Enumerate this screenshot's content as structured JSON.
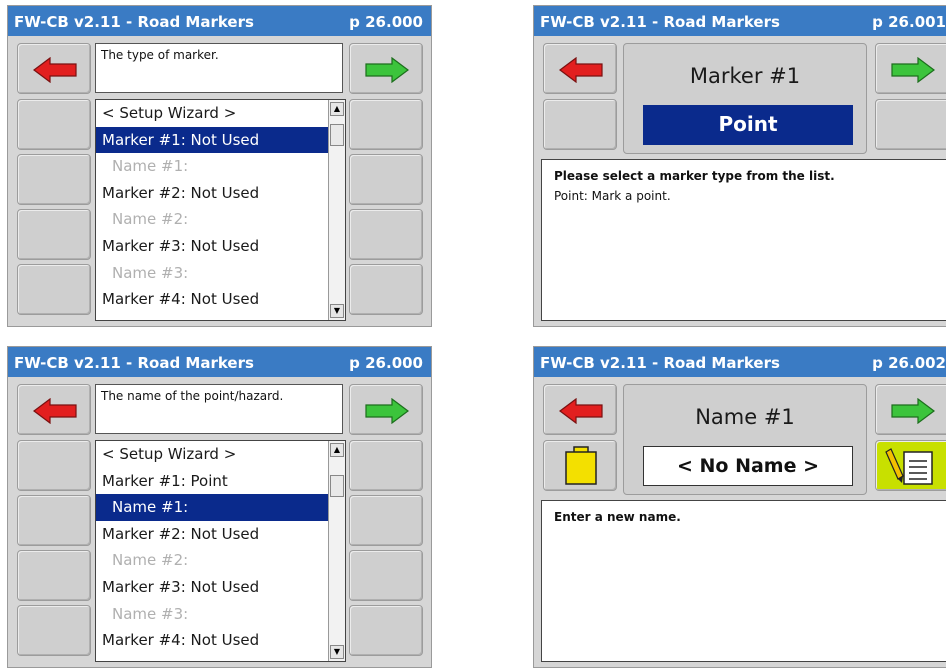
{
  "colors": {
    "title_bar": "#3a7bc4",
    "selection": "#0a2a8c",
    "back_arrow": "#e21f1f",
    "next_arrow": "#3cc43c",
    "folder": "#f3e000",
    "notepad_button": "#c8e000"
  },
  "screens": {
    "top_left": {
      "title": "FW-CB v2.11 - Road Markers",
      "page": "p 26.000",
      "description": "The type of marker.",
      "list": [
        "< Setup Wizard >",
        "Marker #1: Not Used",
        "Name #1:",
        "Marker #2: Not Used",
        "Name #2:",
        "Marker #3: Not Used",
        "Name #3:",
        "Marker #4: Not Used"
      ],
      "selected_index": 1
    },
    "top_right": {
      "title": "FW-CB v2.11 - Road Markers",
      "page": "p 26.001",
      "heading": "Marker #1",
      "value": "Point",
      "help_bold": "Please select a marker type from the list.",
      "help_text": "Point: Mark a point."
    },
    "bottom_left": {
      "title": "FW-CB v2.11 - Road Markers",
      "page": "p 26.000",
      "description": "The name of the point/hazard.",
      "list": [
        "< Setup Wizard >",
        "Marker #1: Point",
        "Name #1:",
        "Marker #2: Not Used",
        "Name #2:",
        "Marker #3: Not Used",
        "Name #3:",
        "Marker #4: Not Used"
      ],
      "selected_index": 2
    },
    "bottom_right": {
      "title": "FW-CB v2.11 - Road Markers",
      "page": "p 26.002",
      "heading": "Name #1",
      "value": "< No Name >",
      "help_bold": "Enter a new name."
    }
  },
  "icons": {
    "back": "left-arrow-icon",
    "next": "right-arrow-icon",
    "folder": "folder-icon",
    "edit": "notepad-pencil-icon"
  }
}
